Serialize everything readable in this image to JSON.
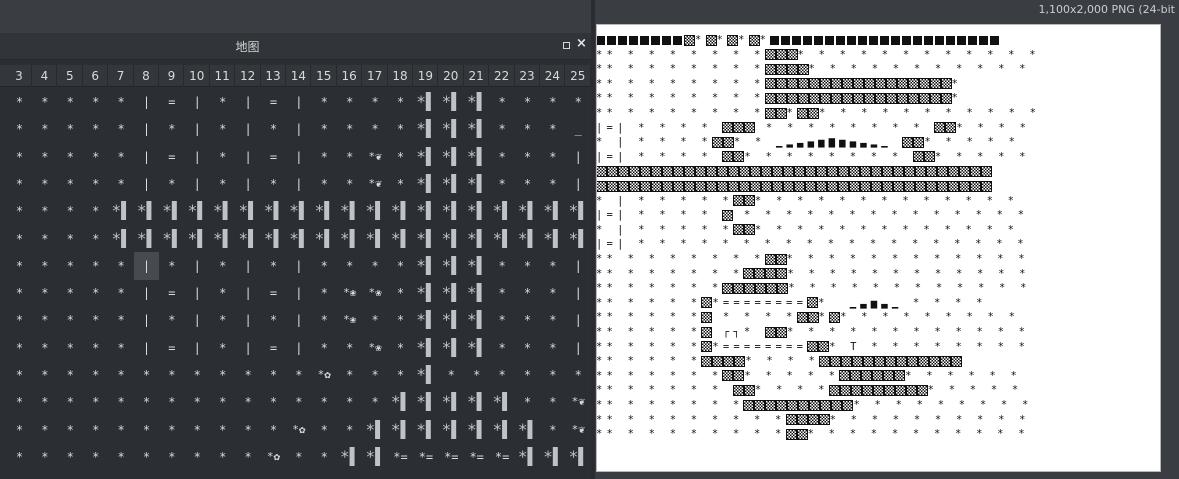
{
  "panel": {
    "title": "地图",
    "float_label": "",
    "close_label": "×"
  },
  "columns": [
    "3",
    "4",
    "5",
    "6",
    "7",
    "8",
    "9",
    "10",
    "11",
    "12",
    "13",
    "14",
    "15",
    "16",
    "17",
    "18",
    "19",
    "20",
    "21",
    "22",
    "23",
    "24",
    "25"
  ],
  "rows": [
    [
      "*",
      "*",
      "*",
      "*",
      "*",
      "|",
      "=",
      "|",
      "*",
      "|",
      "=",
      "|",
      "*",
      "*",
      "*",
      "*",
      "*▌",
      "*▌",
      "*▌",
      "*",
      "*",
      "*",
      "*"
    ],
    [
      "*",
      "*",
      "*",
      "*",
      "*",
      "|",
      "*",
      "|",
      "*",
      "|",
      "*",
      "|",
      "*",
      "*",
      "*",
      "*",
      "*▌",
      "*▌",
      "*▌",
      "*",
      "*",
      "*",
      "_"
    ],
    [
      "*",
      "*",
      "*",
      "*",
      "*",
      "|",
      "=",
      "|",
      "*",
      "|",
      "=",
      "|",
      "*",
      "*",
      "*❦",
      "*",
      "*▌",
      "*▌",
      "*▌",
      "*",
      "*",
      "*",
      "|"
    ],
    [
      "*",
      "*",
      "*",
      "*",
      "*",
      "|",
      "*",
      "|",
      "*",
      "|",
      "*",
      "|",
      "*",
      "*",
      "*❦",
      "*",
      "*▌",
      "*▌",
      "*▌",
      "*",
      "*",
      "*",
      "|"
    ],
    [
      "*",
      "*",
      "*",
      "*",
      "*▌",
      "*▌",
      "*▌",
      "*▌",
      "*▌",
      "*▌",
      "*▌",
      "*▌",
      "*▌",
      "*▌",
      "*▌",
      "*▌",
      "*▌",
      "*▌",
      "*▌",
      "*▌",
      "*▌",
      "*▌",
      "*▌"
    ],
    [
      "*",
      "*",
      "*",
      "*",
      "*▌",
      "*▌",
      "*▌",
      "*▌",
      "*▌",
      "*▌",
      "*▌",
      "*▌",
      "*▌",
      "*▌",
      "*▌",
      "*▌",
      "*▌",
      "*▌",
      "*▌",
      "*▌",
      "*▌",
      "*▌",
      "*▌"
    ],
    [
      "*",
      "*",
      "*",
      "*",
      "*",
      "|",
      "*",
      "|",
      "*",
      "|",
      "*",
      "|",
      "*",
      "*",
      "*",
      "*",
      "*▌",
      "*▌",
      "*▌",
      "*",
      "*",
      "*",
      "|"
    ],
    [
      "*",
      "*",
      "*",
      "*",
      "*",
      "|",
      "=",
      "|",
      "*",
      "|",
      "=",
      "|",
      "*",
      "*❀",
      "*❀",
      "*",
      "*▌",
      "*▌",
      "*▌",
      "*",
      "*",
      "*",
      "|"
    ],
    [
      "*",
      "*",
      "*",
      "*",
      "*",
      "|",
      "*",
      "|",
      "*",
      "|",
      "*",
      "|",
      "*",
      "*❀",
      "*",
      "*",
      "*▌",
      "*▌",
      "*▌",
      "*",
      "*",
      "*",
      "|"
    ],
    [
      "*",
      "*",
      "*",
      "*",
      "*",
      "|",
      "=",
      "|",
      "*",
      "|",
      "=",
      "|",
      "*",
      "*",
      "*❀",
      "*",
      "*▌",
      "*▌",
      "*▌",
      "*",
      "*",
      "*",
      "|"
    ],
    [
      "*",
      "*",
      "*",
      "*",
      "*",
      "*",
      "*",
      "*",
      "*",
      "*",
      "*",
      "*",
      "*✿",
      "*",
      "*",
      "*",
      "*▌",
      "*",
      "*",
      "*",
      "*",
      "*",
      "*"
    ],
    [
      "*",
      "*",
      "*",
      "*",
      "*",
      "*",
      "*",
      "*",
      "*",
      "*",
      "*",
      "*",
      "*",
      "*",
      "*",
      "*▌",
      "*▌",
      "*▌",
      "*▌",
      "*▌",
      "*",
      "*",
      "*❦"
    ],
    [
      "*",
      "*",
      "*",
      "*",
      "*",
      "*",
      "*",
      "*",
      "*",
      "*",
      "*",
      "*✿",
      "*",
      "*",
      "*▌",
      "*▌",
      "*▌",
      "*▌",
      "*▌",
      "*▌",
      "*▌",
      "*",
      "*❦"
    ],
    [
      "*",
      "*",
      "*",
      "*",
      "*",
      "*",
      "*",
      "*",
      "*",
      "*",
      "*✿",
      "*",
      "*",
      "*▌",
      "*▌",
      "*=",
      "*=",
      "*=",
      "*=",
      "*=",
      "*▌",
      "*▌",
      "*▌"
    ]
  ],
  "selected_cell": {
    "row": 6,
    "col": 5
  },
  "viewer": {
    "image_info": "1,100x2,000 PNG (24-bit"
  },
  "colors": {
    "panel_bg": "#2b2e33",
    "header_bg": "#313438",
    "text": "#d9dbde",
    "canvas_bg": "#ffffff",
    "ink": "#111111"
  }
}
